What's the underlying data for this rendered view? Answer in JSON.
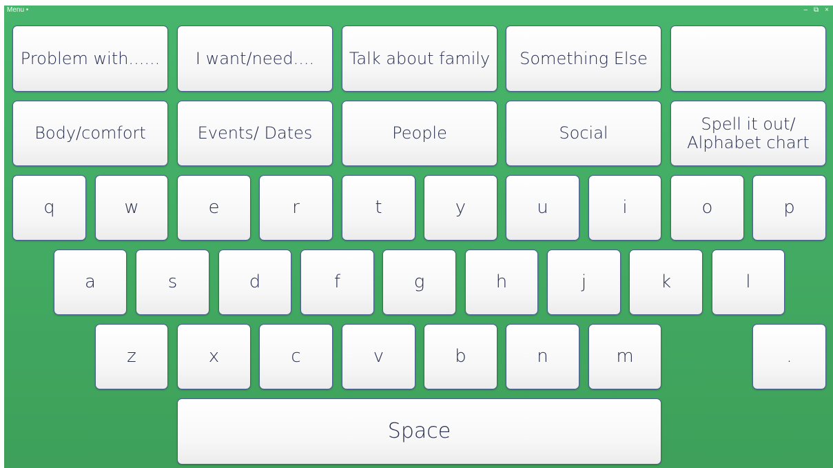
{
  "titlebar": {
    "menu_label": "Menu •",
    "minimize_glyph": "–",
    "restore_glyph": "⧉",
    "close_glyph": "×"
  },
  "phrases": {
    "row1": [
      "Problem with......",
      "I want/need....",
      "Talk about family",
      "Something Else",
      ""
    ],
    "row2": [
      "Body/comfort",
      "Events/ Dates",
      "People",
      "Social",
      "Spell it out/\nAlphabet chart"
    ]
  },
  "keyboard": {
    "row1": [
      "q",
      "w",
      "e",
      "r",
      "t",
      "y",
      "u",
      "i",
      "o",
      "p"
    ],
    "row2": [
      "a",
      "s",
      "d",
      "f",
      "g",
      "h",
      "j",
      "k",
      "l"
    ],
    "row3": [
      "z",
      "x",
      "c",
      "v",
      "b",
      "n",
      "m"
    ],
    "period": ".",
    "space": "Space"
  },
  "colors": {
    "background_top": "#47b66c",
    "background_bottom": "#3ea05a",
    "key_text": "#262c4f",
    "key_border": "#4b5c8f"
  }
}
